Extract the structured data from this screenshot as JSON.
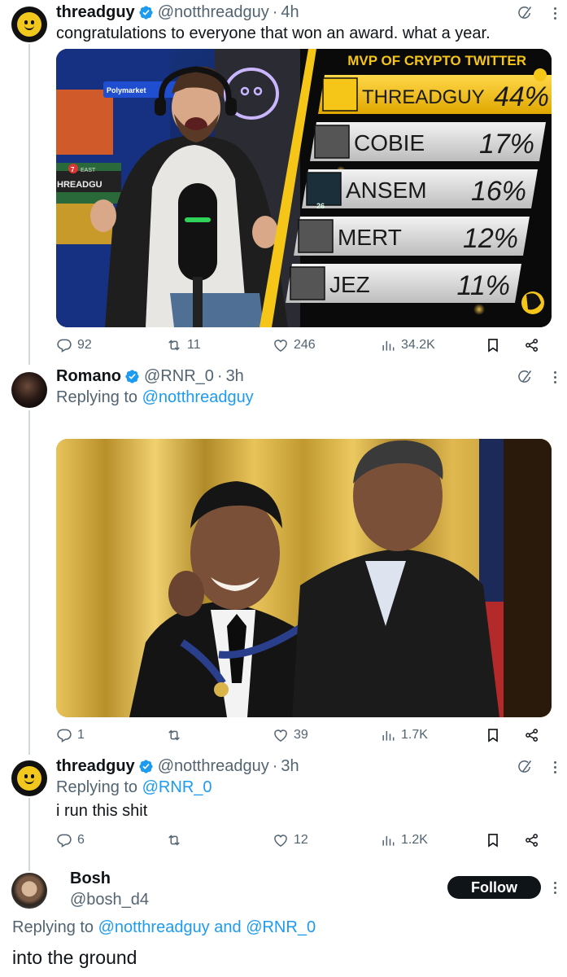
{
  "tweets": [
    {
      "name": "threadguy",
      "handle": "@notthreadguy",
      "time": "4h",
      "text": "congratulations to everyone that won an award. what a year.",
      "replies": "92",
      "retweets": "11",
      "likes": "246",
      "views": "34.2K",
      "media": {
        "title": "MVP OF CRYPTO TWITTER",
        "booth_sign": "Polymarket",
        "banner_number": "7",
        "banner_small": "EAST",
        "banner_text": "HREADGU",
        "poll": [
          {
            "name": "THREADGUY",
            "pct": "44%",
            "value": 44
          },
          {
            "name": "COBIE",
            "pct": "17%",
            "value": 17
          },
          {
            "name": "ANSEM",
            "pct": "16%",
            "value": 16
          },
          {
            "name": "MERT",
            "pct": "12%",
            "value": 12
          },
          {
            "name": "JEZ",
            "pct": "11%",
            "value": 11
          }
        ],
        "jersey_number": "26"
      }
    },
    {
      "name": "Romano",
      "handle": "@RNR_0",
      "time": "3h",
      "replying_label": "Replying to",
      "replying_to": "@notthreadguy",
      "replies": "1",
      "retweets": "",
      "likes": "39",
      "views": "1.7K"
    },
    {
      "name": "threadguy",
      "handle": "@notthreadguy",
      "time": "3h",
      "replying_label": "Replying to",
      "replying_to": "@RNR_0",
      "text": "i run this shit",
      "replies": "6",
      "retweets": "",
      "likes": "12",
      "views": "1.2K"
    },
    {
      "name": "Bosh",
      "handle": "@bosh_d4",
      "follow_label": "Follow",
      "replying_label": "Replying to",
      "replying_to_1": "@notthreadguy",
      "and_label": "and",
      "replying_to_2": "@RNR_0",
      "text": "into the ground"
    }
  ],
  "colors": {
    "accent": "#1d9bf0",
    "muted": "#536471",
    "gold": "#f5c518"
  },
  "icons": [
    "reply-icon",
    "retweet-icon",
    "like-icon",
    "views-icon",
    "bookmark-icon",
    "share-icon",
    "grok-icon",
    "more-icon",
    "verified-icon"
  ]
}
